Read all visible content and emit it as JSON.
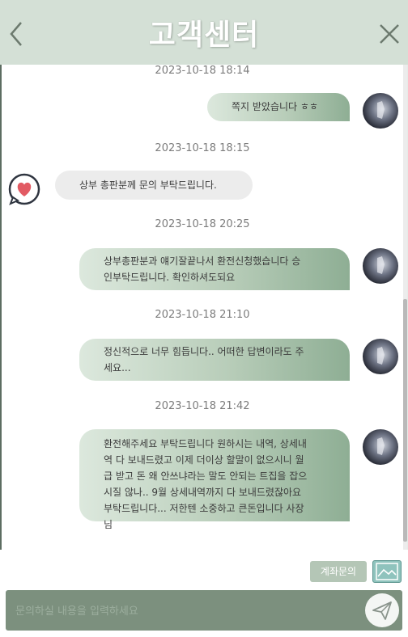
{
  "header": {
    "title": "고객센터",
    "back_icon": "chevron-left-icon",
    "close_icon": "close-icon"
  },
  "messages": [
    {
      "timestamp": "2023-10-18 18:14",
      "direction": "out",
      "text": "쪽지 받았습니다 ㅎㅎ"
    },
    {
      "timestamp": "2023-10-18 18:15",
      "direction": "in",
      "text": "상부 총판분께 문의 부탁드립니다."
    },
    {
      "timestamp": "2023-10-18 20:25",
      "direction": "out",
      "lines": [
        "상부총판분과 얘기잘끝나서 환전신청했습니다 승",
        "인부탁드립니다. 확인하셔도되요"
      ]
    },
    {
      "timestamp": "2023-10-18 21:10",
      "direction": "out",
      "lines": [
        "정신적으로 너무 힘듭니다.. 어떠한 답변이라도 주",
        "세요..."
      ]
    },
    {
      "timestamp": "2023-10-18 21:42",
      "direction": "out",
      "lines": [
        "환전해주세요 부탁드립니다 원하시는 내역, 상세내",
        "역 다 보내드렸고 이제 더이상 할말이 없으시니 월",
        "급 받고 돈 왜 안쓰냐라는 말도 안되는 트집을 잡으",
        "시질 않나.. 9월 상세내역까지 다 보내드렸잖아요",
        "부탁드립니다... 저한텐 소중하고 큰돈입니다 사장",
        "님"
      ]
    }
  ],
  "footer": {
    "account_button_label": "계좌문의",
    "image_icon": "image-icon",
    "input_placeholder": "문의하실 내용을 입력하세요",
    "send_icon": "send-icon"
  },
  "colors": {
    "header_bg": "#d4e0d6",
    "bubble_gradient_end": "#8eae94",
    "input_bg": "#7c907e",
    "account_button_bg": "#b4c6b6",
    "image_button_bg": "#8fc3bd"
  }
}
